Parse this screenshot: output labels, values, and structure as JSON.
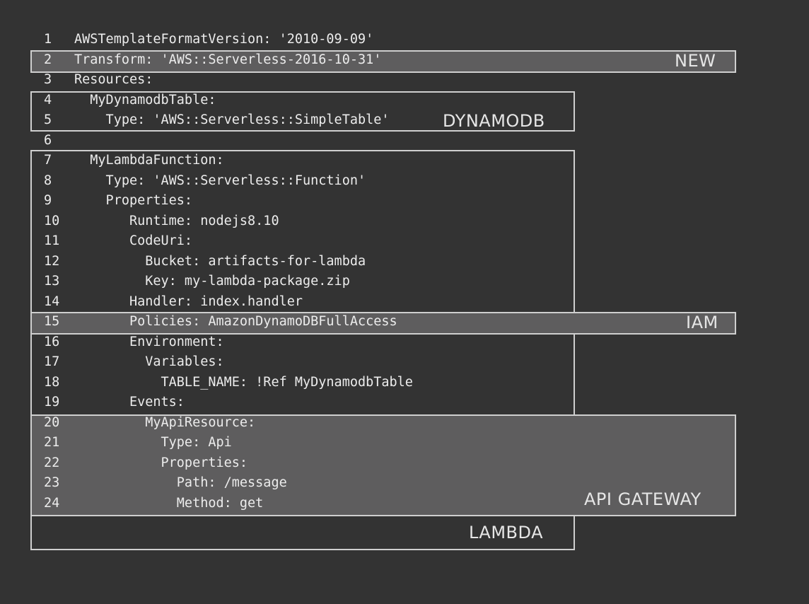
{
  "code": {
    "lines": [
      {
        "num": "1",
        "text": "AWSTemplateFormatVersion: '2010-09-09'"
      },
      {
        "num": "2",
        "text": "Transform: 'AWS::Serverless-2016-10-31'"
      },
      {
        "num": "3",
        "text": "Resources:"
      },
      {
        "num": "4",
        "text": "  MyDynamodbTable:"
      },
      {
        "num": "5",
        "text": "    Type: 'AWS::Serverless::SimpleTable'"
      },
      {
        "num": "6",
        "text": ""
      },
      {
        "num": "7",
        "text": "  MyLambdaFunction:"
      },
      {
        "num": "8",
        "text": "    Type: 'AWS::Serverless::Function'"
      },
      {
        "num": "9",
        "text": "    Properties:"
      },
      {
        "num": "10",
        "text": "       Runtime: nodejs8.10"
      },
      {
        "num": "11",
        "text": "       CodeUri:"
      },
      {
        "num": "12",
        "text": "         Bucket: artifacts-for-lambda"
      },
      {
        "num": "13",
        "text": "         Key: my-lambda-package.zip"
      },
      {
        "num": "14",
        "text": "       Handler: index.handler"
      },
      {
        "num": "15",
        "text": "       Policies: AmazonDynamoDBFullAccess"
      },
      {
        "num": "16",
        "text": "       Environment:"
      },
      {
        "num": "17",
        "text": "         Variables:"
      },
      {
        "num": "18",
        "text": "           TABLE_NAME: !Ref MyDynamodbTable"
      },
      {
        "num": "19",
        "text": "       Events:"
      },
      {
        "num": "20",
        "text": "         MyApiResource:"
      },
      {
        "num": "21",
        "text": "           Type: Api"
      },
      {
        "num": "22",
        "text": "           Properties:"
      },
      {
        "num": "23",
        "text": "             Path: /message"
      },
      {
        "num": "24",
        "text": "             Method: get"
      }
    ]
  },
  "labels": {
    "new": "NEW",
    "dynamodb": "DYNAMODB",
    "iam": "IAM",
    "api_gateway": "API GATEWAY",
    "lambda": "LAMBDA"
  },
  "colors": {
    "background": "#333333",
    "highlight_fill": "#5e5d5e",
    "box_border": "#cfcfcf",
    "text": "#ececec"
  }
}
